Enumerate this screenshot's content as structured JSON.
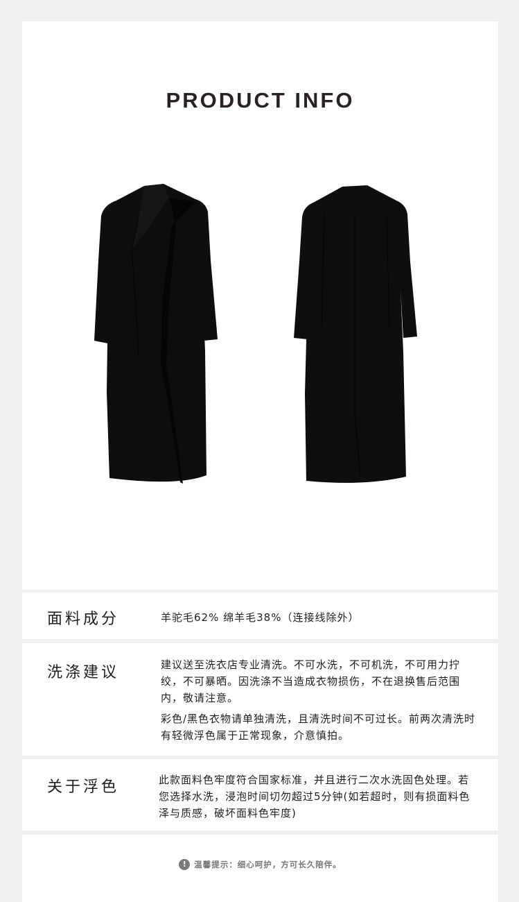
{
  "header": {
    "title": "PRODUCT INFO"
  },
  "product": {
    "front_image_icon": "coat-front-icon",
    "back_image_icon": "coat-back-icon",
    "garment_color": "#0e0e0e"
  },
  "fabric": {
    "label": "面料成分",
    "text": "羊驼毛62% 绵羊毛38%（连接线除外）"
  },
  "washing": {
    "label": "洗涤建议",
    "para1": "建议送至洗衣店专业清洗。不可水洗，不可机洗，不可用力拧绞，不可暴晒。因洗涤不当造成衣物损伤，不在退换售后范围内，敬请注意。",
    "para2": "彩色/黑色衣物请单独清洗，且清洗时间不可过长。前两次清洗时有轻微浮色属于正常现象，介意慎拍。"
  },
  "color_fading": {
    "label": "关于浮色",
    "text": "此款面料色牢度符合国家标准，并且进行二次水洗固色处理。若您选择水洗，浸泡时间切勿超过5分钟(如若超时，则有损面料色泽与质感，破坏面料色牢度)"
  },
  "footer": {
    "icon": "!",
    "notice": "温馨提示：细心呵护，方可长久陪伴。"
  }
}
